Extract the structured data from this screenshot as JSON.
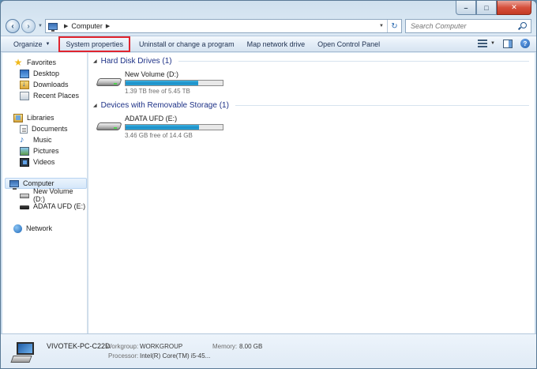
{
  "window": {
    "caption_min": "–",
    "caption_max": "□",
    "caption_close": "✕"
  },
  "address": {
    "crumb": "Computer",
    "search_placeholder": "Search Computer"
  },
  "commands": {
    "organize": "Organize",
    "system_properties": "System properties",
    "uninstall": "Uninstall or change a program",
    "map_drive": "Map network drive",
    "control_panel": "Open Control Panel"
  },
  "nav": {
    "favorites": "Favorites",
    "desktop": "Desktop",
    "downloads": "Downloads",
    "recent_places": "Recent Places",
    "libraries": "Libraries",
    "documents": "Documents",
    "music": "Music",
    "pictures": "Pictures",
    "videos": "Videos",
    "computer": "Computer",
    "new_volume": "New Volume (D:)",
    "adata": "ADATA UFD (E:)",
    "network": "Network"
  },
  "content": {
    "hdd_group": "Hard Disk Drives (1)",
    "removable_group": "Devices with Removable Storage (1)",
    "drives": [
      {
        "name": "New Volume (D:)",
        "free_text": "1.39 TB free of 5.45 TB",
        "used_fraction": 0.745
      },
      {
        "name": "ADATA UFD (E:)",
        "free_text": "3.46 GB free of 14.4 GB",
        "used_fraction": 0.76
      }
    ]
  },
  "details": {
    "pc_name": "VIVOTEK-PC-C22D",
    "workgroup_label": "Workgroup:",
    "workgroup_value": "WORKGROUP",
    "memory_label": "Memory:",
    "memory_value": "8.00 GB",
    "processor_label": "Processor:",
    "processor_value": "Intel(R) Core(TM) i5-45..."
  },
  "colors": {
    "highlight_box": "#e0242e",
    "bar_fill": "#27a2d6",
    "group_title": "#1e3287"
  },
  "icons": [
    "back-icon",
    "forward-icon",
    "computer-icon",
    "refresh-icon",
    "search-icon",
    "view-icon",
    "preview-pane-icon",
    "help-icon",
    "star-icon",
    "desktop-icon",
    "downloads-icon",
    "recent-places-icon",
    "libraries-icon",
    "documents-icon",
    "music-icon",
    "pictures-icon",
    "videos-icon",
    "drive-icon",
    "usb-drive-icon",
    "network-icon"
  ]
}
